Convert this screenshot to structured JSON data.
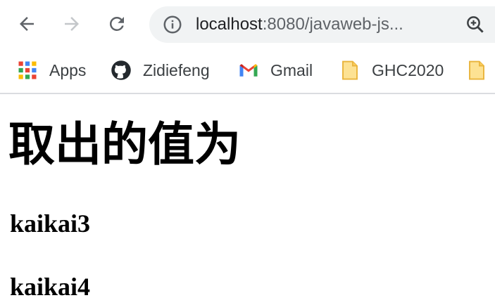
{
  "browser": {
    "url_host": "localhost",
    "url_rest": ":8080/javaweb-js...",
    "bookmarks": [
      {
        "label": "Apps",
        "icon": "apps-grid-icon"
      },
      {
        "label": "Zidiefeng",
        "icon": "github-icon"
      },
      {
        "label": "Gmail",
        "icon": "gmail-icon"
      },
      {
        "label": "GHC2020",
        "icon": "folder-icon"
      },
      {
        "label": "",
        "icon": "folder-icon"
      }
    ]
  },
  "page": {
    "heading": "取出的值为",
    "values": [
      "kaikai3",
      "kaikai4"
    ]
  }
}
